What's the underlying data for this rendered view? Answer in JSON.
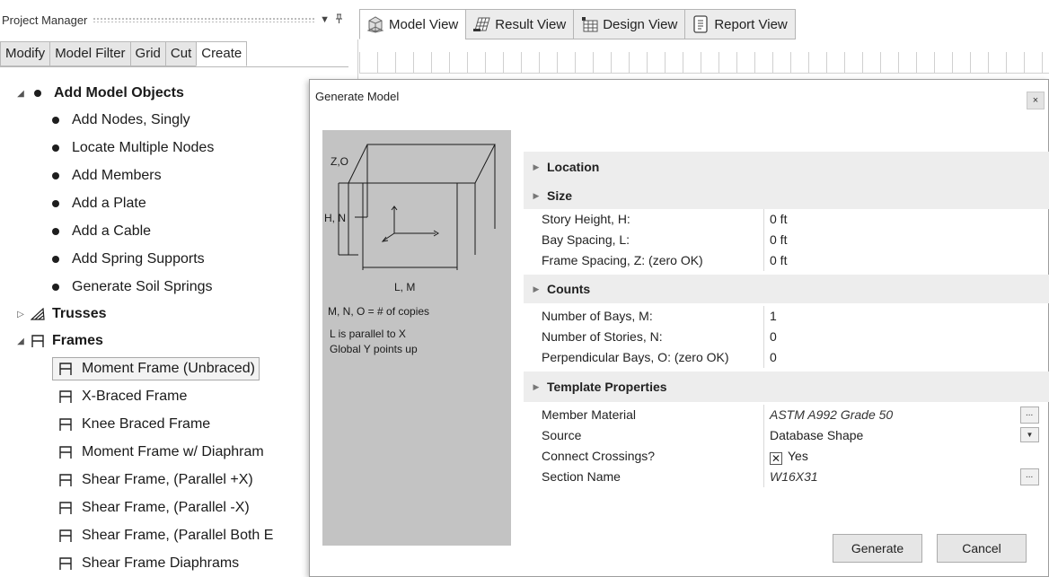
{
  "project_manager": {
    "title": "Project Manager",
    "pin_icon": "pin-icon",
    "tabs": [
      "Modify",
      "Model Filter",
      "Grid",
      "Cut",
      "Create"
    ],
    "active_tab": "Create",
    "tree": {
      "add_model_objects": {
        "label": "Add Model Objects",
        "items": [
          "Add Nodes, Singly",
          "Locate Multiple Nodes",
          "Add Members",
          "Add a Plate",
          "Add a Cable",
          "Add Spring Supports",
          "Generate Soil Springs"
        ]
      },
      "trusses": {
        "label": "Trusses"
      },
      "frames": {
        "label": "Frames",
        "items": [
          "Moment Frame (Unbraced)",
          "X-Braced Frame",
          "Knee Braced Frame",
          "Moment Frame w/ Diaphram",
          "Shear Frame, (Parallel +X)",
          "Shear Frame, (Parallel -X)",
          "Shear Frame, (Parallel Both E",
          "Shear Frame  Diaphrams"
        ],
        "selected": "Moment Frame (Unbraced)"
      }
    }
  },
  "view_tabs": [
    {
      "label": "Model View",
      "icon": "model-view-icon"
    },
    {
      "label": "Result View",
      "icon": "result-view-icon"
    },
    {
      "label": "Design View",
      "icon": "design-view-icon"
    },
    {
      "label": "Report View",
      "icon": "report-view-icon"
    }
  ],
  "dialog": {
    "title": "Generate Model",
    "close_label": "×",
    "diagram": {
      "label_zo": "Z,O",
      "label_hn": "H, N",
      "label_lm": "L, M",
      "note1": "M, N, O = # of copies",
      "note2": "L is parallel to X",
      "note3": "Global Y points up"
    },
    "sections": {
      "location": "Location",
      "size": "Size",
      "counts": "Counts",
      "template": "Template Properties"
    },
    "size_props": [
      {
        "label": "Story Height, H:",
        "value": "0 ft"
      },
      {
        "label": "Bay Spacing, L:",
        "value": "0 ft"
      },
      {
        "label": "Frame Spacing, Z: (zero OK)",
        "value": "0 ft"
      }
    ],
    "count_props": [
      {
        "label": "Number of Bays, M:",
        "value": "1"
      },
      {
        "label": "Number of Stories, N:",
        "value": "0"
      },
      {
        "label": "Perpendicular Bays, O: (zero OK)",
        "value": "0"
      }
    ],
    "template_props": {
      "member_material": {
        "label": "Member Material",
        "value": "ASTM A992 Grade 50",
        "button": "..."
      },
      "source": {
        "label": "Source",
        "value": "Database Shape"
      },
      "connect_crossings": {
        "label": "Connect Crossings?",
        "value": "Yes",
        "checked": true
      },
      "section_name": {
        "label": "Section Name",
        "value": "W16X31",
        "button": "..."
      }
    },
    "buttons": {
      "generate": "Generate",
      "cancel": "Cancel"
    }
  }
}
